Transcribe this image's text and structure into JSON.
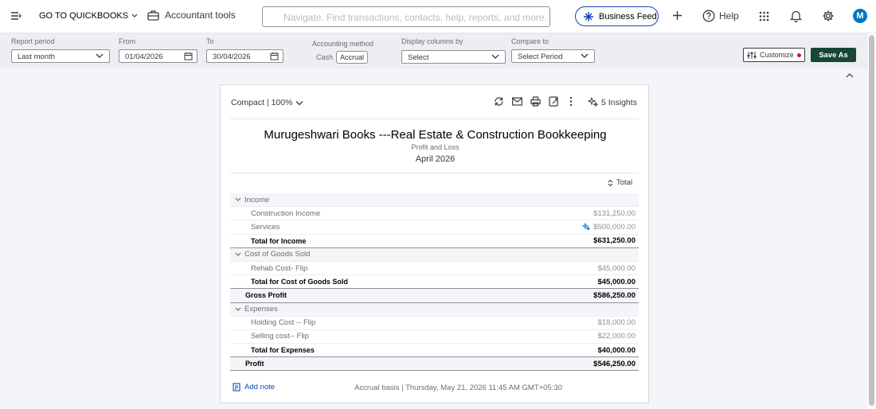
{
  "topbar": {
    "goto_label": "GO TO QUICKBOOKS",
    "accountant_label": "Accountant tools",
    "search_placeholder": "Navigate. Find transactions, contacts, help, reports, and more.",
    "business_feed_label": "Business Feed",
    "help_label": "Help",
    "avatar_initial": "M"
  },
  "filters": {
    "report_period_label": "Report period",
    "report_period_value": "Last month",
    "from_label": "From",
    "from_value": "01/04/2026",
    "to_label": "To",
    "to_value": "30/04/2026",
    "accounting_method_label": "Accounting method",
    "method_cash": "Cash",
    "method_accrual": "Accrual",
    "display_columns_label": "Display columns by",
    "display_columns_value": "Select",
    "compare_label": "Compare to",
    "compare_value": "Select Period",
    "customize_label": "Customize",
    "save_as_label": "Save As"
  },
  "report": {
    "view_label": "Compact | 100%",
    "insights_label": "5 Insights",
    "company": "Murugeshwari Books ---Real Estate & Construction Bookkeeping",
    "type": "Profit and Loss",
    "period": "April 2026",
    "column_header": "Total",
    "rows": [
      {
        "kind": "section",
        "label": "Income",
        "amount": ""
      },
      {
        "kind": "item",
        "label": "Construction Income",
        "amount": "$131,250.00"
      },
      {
        "kind": "item",
        "label": "Services",
        "amount": "$500,000.00"
      },
      {
        "kind": "total",
        "label": "Total for Income",
        "amount": "$631,250.00"
      },
      {
        "kind": "section",
        "label": "Cost of Goods Sold",
        "amount": ""
      },
      {
        "kind": "item",
        "label": "Rehab Cost- Flip",
        "amount": "$45,000.00"
      },
      {
        "kind": "total",
        "label": "Total for Cost of Goods Sold",
        "amount": "$45,000.00"
      },
      {
        "kind": "grand",
        "label": "Gross Profit",
        "amount": "$586,250.00"
      },
      {
        "kind": "section",
        "label": "Expenses",
        "amount": ""
      },
      {
        "kind": "item",
        "label": "Holding Cost -- Flip",
        "amount": "$18,000.00"
      },
      {
        "kind": "item",
        "label": "Selling cost-- Flip",
        "amount": "$22,000.00"
      },
      {
        "kind": "total",
        "label": "Total for Expenses",
        "amount": "$40,000.00"
      },
      {
        "kind": "grand",
        "label": "Profit",
        "amount": "$546,250.00"
      }
    ],
    "add_note_label": "Add note",
    "basis_footer": "Accrual basis  |  Thursday, May 21, 2026 11:45 AM GMT+05:30"
  },
  "colors": {
    "accent_blue": "#0d47b5",
    "save_green": "#154734",
    "customize_dot": "#d1097b"
  }
}
